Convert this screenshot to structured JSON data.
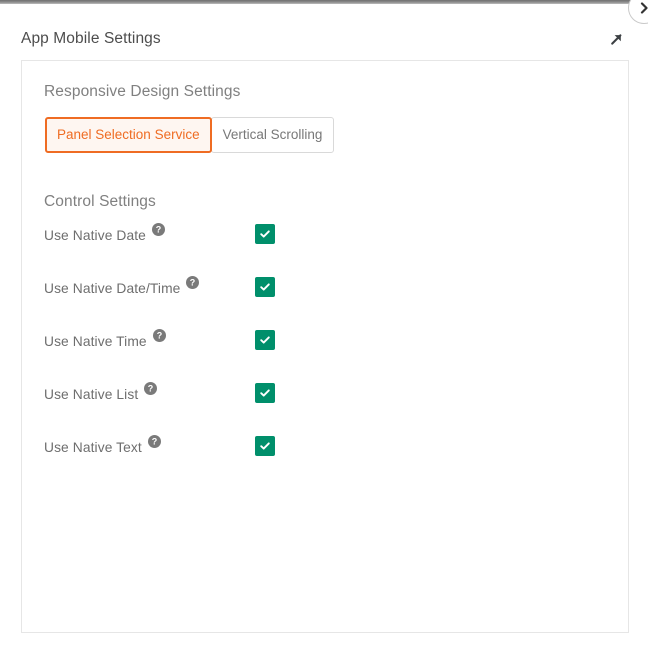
{
  "window": {
    "top_bar_color": "#8e8e8e",
    "collapse_button_icon": "chevron-right-icon"
  },
  "header": {
    "title": "App Mobile Settings",
    "expand_icon": "arrow-up-right-icon"
  },
  "card": {
    "sections": [
      {
        "id": "responsive-design",
        "heading": "Responsive Design Settings",
        "tabs": [
          {
            "label": "Panel Selection Service",
            "active": true
          },
          {
            "label": "Vertical Scrolling",
            "active": false
          }
        ]
      },
      {
        "id": "control-settings",
        "heading": "Control Settings",
        "rows": [
          {
            "label": "Use Native Date",
            "help_icon": "help-circle-icon",
            "checked": true
          },
          {
            "label": "Use Native Date/Time",
            "help_icon": "help-circle-icon",
            "checked": true
          },
          {
            "label": "Use Native Time",
            "help_icon": "help-circle-icon",
            "checked": true
          },
          {
            "label": "Use Native List",
            "help_icon": "help-circle-icon",
            "checked": true
          },
          {
            "label": "Use Native Text",
            "help_icon": "help-circle-icon",
            "checked": true
          }
        ]
      }
    ]
  },
  "colors": {
    "accent_orange": "#ef6c23",
    "accent_orange_bg": "#fef6f1",
    "checkbox_green": "#008f6b",
    "text_gray": "#6e6e6e",
    "heading_gray": "#808080",
    "border_gray": "#e6e6e6"
  }
}
